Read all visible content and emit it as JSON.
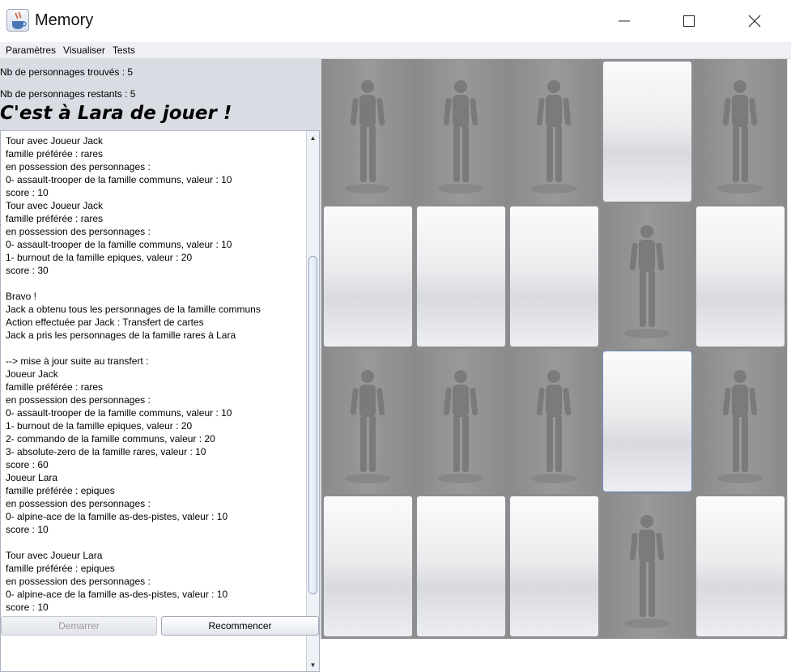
{
  "window": {
    "title": "Memory"
  },
  "menu": [
    "Paramètres",
    "Visualiser",
    "Tests"
  ],
  "status": {
    "found": "Nb de personnages trouvés : 5",
    "remaining": "Nb de personnages restants : 5",
    "turn": "C'est à Lara de jouer !"
  },
  "log": [
    "Tour avec Joueur Jack",
    "famille préférée : rares",
    "en possession des personnages :",
    "0- assault-trooper de la famille communs, valeur : 10",
    "score : 10",
    "Tour avec Joueur Jack",
    "famille préférée : rares",
    "en possession des personnages :",
    "0- assault-trooper de la famille communs, valeur : 10",
    "1- burnout de la famille epiques, valeur : 20",
    "score : 30",
    "",
    "Bravo !",
    "Jack a obtenu tous les personnages de la famille communs",
    "Action effectuée par Jack : Transfert de cartes",
    "Jack a pris les personnages de la famille rares à Lara",
    "",
    "--> mise à jour suite au transfert :",
    "Joueur Jack",
    "famille préférée : rares",
    "en possession des personnages :",
    "0- assault-trooper de la famille communs, valeur : 10",
    "1- burnout de la famille epiques, valeur : 20",
    "2- commando de la famille communs, valeur : 20",
    "3- absolute-zero de la famille rares, valeur : 10",
    "score : 60",
    "Joueur Lara",
    "famille préférée : epiques",
    "en possession des personnages :",
    "0- alpine-ace de la famille as-des-pistes, valeur : 10",
    "score : 10",
    "",
    "Tour avec Joueur Lara",
    "famille préférée : epiques",
    "en possession des personnages :",
    "0- alpine-ace de la famille as-des-pistes, valeur : 10",
    "score : 10"
  ],
  "buttons": {
    "start": "Demarrer",
    "restart": "Recommencer"
  },
  "board": {
    "rows": [
      [
        "face",
        "face",
        "face",
        "back",
        "face"
      ],
      [
        "back",
        "back",
        "back",
        "face",
        "back"
      ],
      [
        "face",
        "face",
        "face",
        "selected",
        "face"
      ],
      [
        "back",
        "back",
        "back",
        "face",
        "back"
      ]
    ]
  },
  "icons": {
    "app": "java-cup-icon",
    "minimize": "minimize-icon",
    "maximize": "maximize-icon",
    "close": "close-icon"
  },
  "colors": {
    "board_bg": "#8d8d8d",
    "panel_bg": "#d9dce3",
    "card_face": "#f1f1f3"
  }
}
